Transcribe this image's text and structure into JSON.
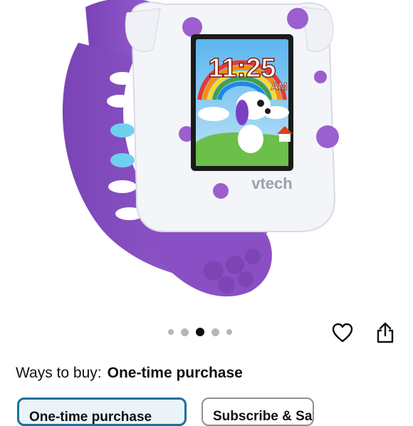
{
  "product": {
    "image_alt": "VTech watch with purple band",
    "screen_time": "11:25",
    "screen_ampm": "AM",
    "brand_logo": "vtech"
  },
  "carousel": {
    "count": 5,
    "active_index": 2
  },
  "actions": {
    "favorite_icon": "heart-icon",
    "share_icon": "share-icon"
  },
  "purchase": {
    "ways_label": "Ways to buy:",
    "ways_value": "One-time purchase",
    "options": [
      "One-time purchase",
      "Subscribe & Save"
    ]
  },
  "colors": {
    "accent": "#1d6f9c",
    "band": "#8a4fc4",
    "text": "#0f1111"
  }
}
